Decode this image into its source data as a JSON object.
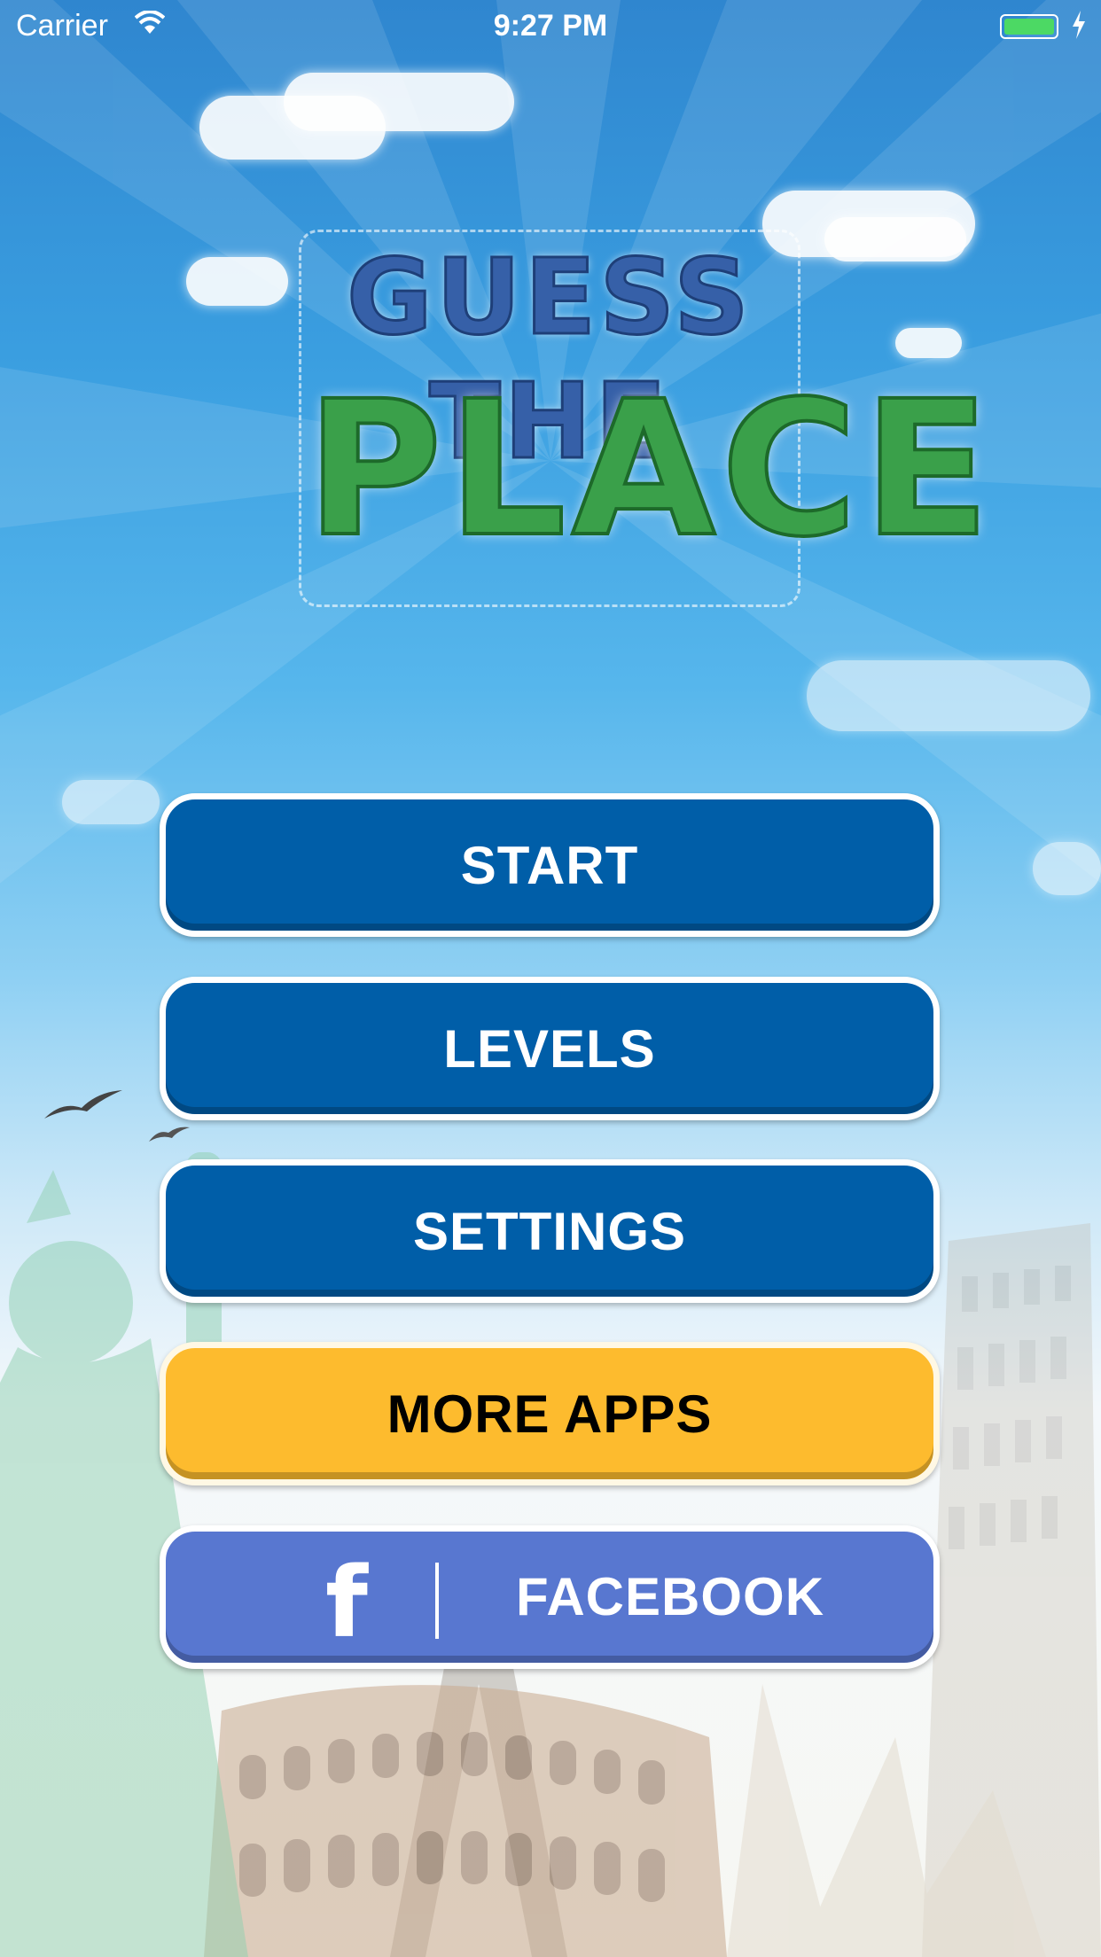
{
  "status_bar": {
    "carrier": "Carrier",
    "time": "9:27 PM",
    "wifi_icon": "wifi-icon",
    "battery_icon": "battery-charging-icon"
  },
  "logo": {
    "line1": "GUESS THE",
    "line2": "PLACE"
  },
  "menu": {
    "start": "START",
    "levels": "LEVELS",
    "settings": "SETTINGS",
    "more_apps": "MORE APPS",
    "facebook": "FACEBOOK",
    "facebook_icon": "facebook-f-icon"
  },
  "colors": {
    "primary_button": "#005ea8",
    "more_apps_button": "#fdbb2e",
    "facebook_button": "#5877d0",
    "logo_blue": "#3660a8",
    "logo_green": "#3aa04a"
  }
}
